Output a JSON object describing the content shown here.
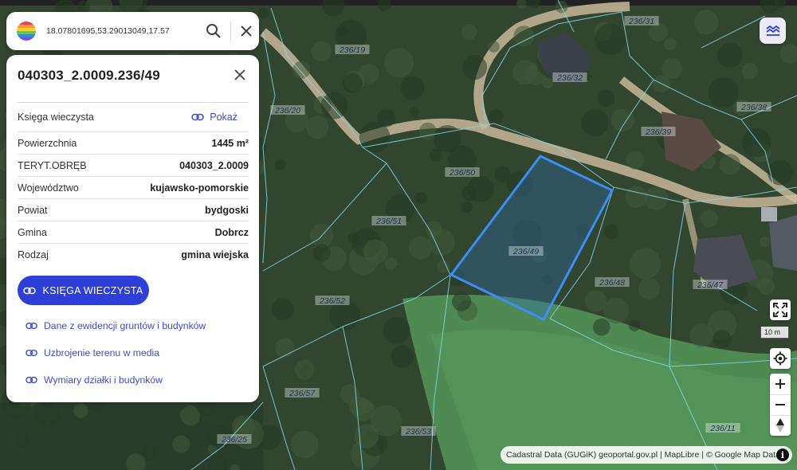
{
  "search": {
    "value": "18.07801695,53.29013049,17.57"
  },
  "panel": {
    "title": "040303_2.0009.236/49",
    "rows": [
      {
        "label": "Księga wieczysta",
        "value": "Pokaż"
      },
      {
        "label": "Powierzchnia",
        "value": "1445 m²"
      },
      {
        "label": "TERYT.OBRĘB",
        "value": "040303_2.0009"
      },
      {
        "label": "Województwo",
        "value": "kujawsko-pomorskie"
      },
      {
        "label": "Powiat",
        "value": "bydgoski"
      },
      {
        "label": "Gmina",
        "value": "Dobrcz"
      },
      {
        "label": "Rodzaj",
        "value": "gmina wiejska"
      }
    ],
    "main_button": "KSIĘGA WIECZYSTA",
    "links": [
      "Dane z ewidencji gruntów i budynków",
      "Uzbrojenie terenu w media",
      "Wymiary działki i budynków"
    ]
  },
  "map": {
    "parcel_labels": [
      "236/31",
      "236/19",
      "236/32",
      "236/20",
      "236/38",
      "236/39",
      "236/50",
      "236/51",
      "236/49",
      "236/48",
      "236/47",
      "236/52",
      "236/57",
      "236/53",
      "236/25",
      "236/11"
    ],
    "scale": "10 m",
    "attribution": "Cadastral Data (GUGiK) geoportal.gov.pl | MapLibre | © Google Map Data",
    "selected_color": "#3a8ef5",
    "boundary_color": "#7fd8ef"
  },
  "icons": {
    "logo": "rainbow-logo",
    "search": "search-icon",
    "clear": "close-icon",
    "panel_close": "close-icon",
    "link": "link-icon",
    "layers": "layers-icon",
    "fullscreen": "fullscreen-icon",
    "geolocate": "geolocate-icon",
    "zoom_in": "plus-icon",
    "zoom_out": "minus-icon",
    "compass": "compass-icon",
    "info": "info-icon"
  }
}
